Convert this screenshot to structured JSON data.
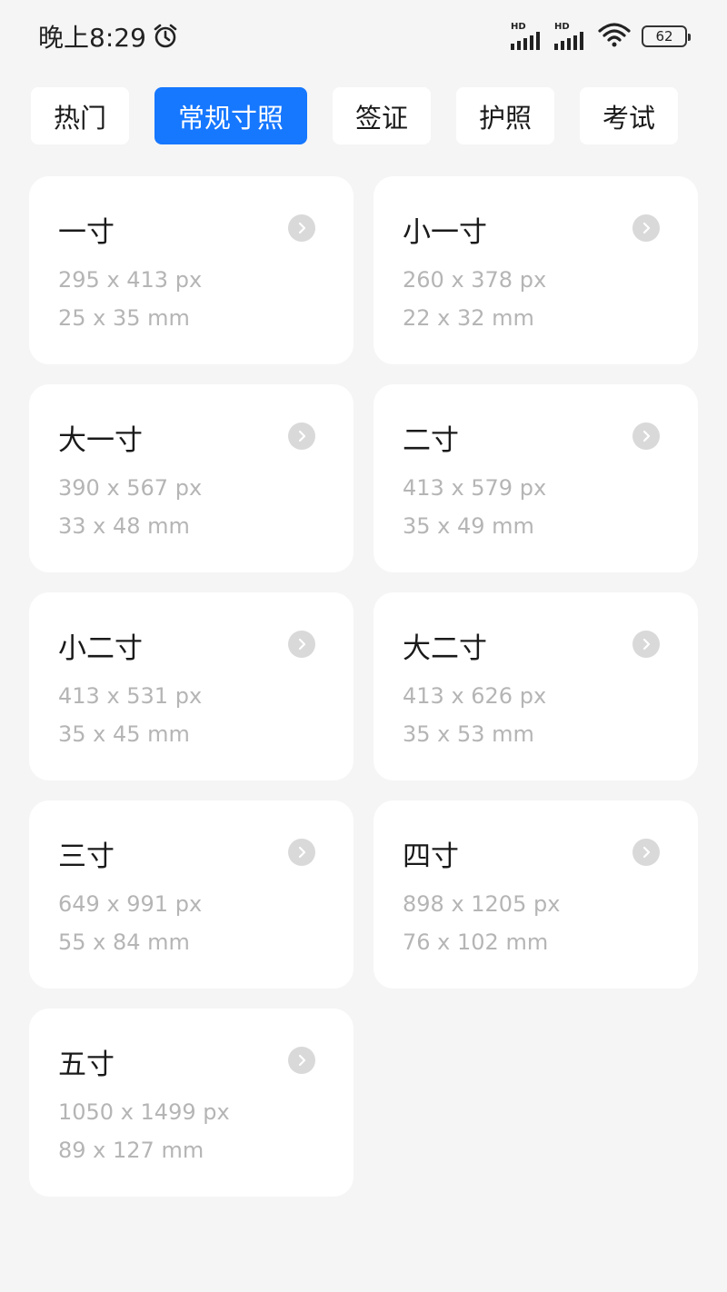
{
  "status_bar": {
    "time": "晚上8:29",
    "signal1_label": "HD",
    "signal2_label": "HD",
    "battery": "62"
  },
  "tabs": [
    {
      "label": "热门",
      "active": false
    },
    {
      "label": "常规寸照",
      "active": true
    },
    {
      "label": "签证",
      "active": false
    },
    {
      "label": "护照",
      "active": false
    },
    {
      "label": "考试",
      "active": false
    }
  ],
  "sizes": [
    {
      "name": "一寸",
      "px": "295 x 413 px",
      "mm": "25 x 35 mm"
    },
    {
      "name": "小一寸",
      "px": "260 x 378 px",
      "mm": "22 x 32 mm"
    },
    {
      "name": "大一寸",
      "px": "390 x 567 px",
      "mm": "33 x 48 mm"
    },
    {
      "name": "二寸",
      "px": "413 x 579 px",
      "mm": "35 x 49 mm"
    },
    {
      "name": "小二寸",
      "px": "413 x 531 px",
      "mm": "35 x 45 mm"
    },
    {
      "name": "大二寸",
      "px": "413 x 626 px",
      "mm": "35 x 53 mm"
    },
    {
      "name": "三寸",
      "px": "649 x 991 px",
      "mm": "55 x 84 mm"
    },
    {
      "name": "四寸",
      "px": "898 x 1205 px",
      "mm": "76 x 102 mm"
    },
    {
      "name": "五寸",
      "px": "1050 x 1499 px",
      "mm": "89 x 127 mm"
    }
  ],
  "colors": {
    "accent": "#1677ff",
    "background": "#f5f5f5",
    "card": "#ffffff",
    "secondary_text": "#b5b5b5",
    "arrow_circle": "#d9d9d9"
  },
  "icons": {
    "alarm": "alarm-icon",
    "signal": "signal-icon",
    "wifi": "wifi-icon",
    "battery": "battery-icon",
    "arrow": "chevron-right-icon"
  }
}
